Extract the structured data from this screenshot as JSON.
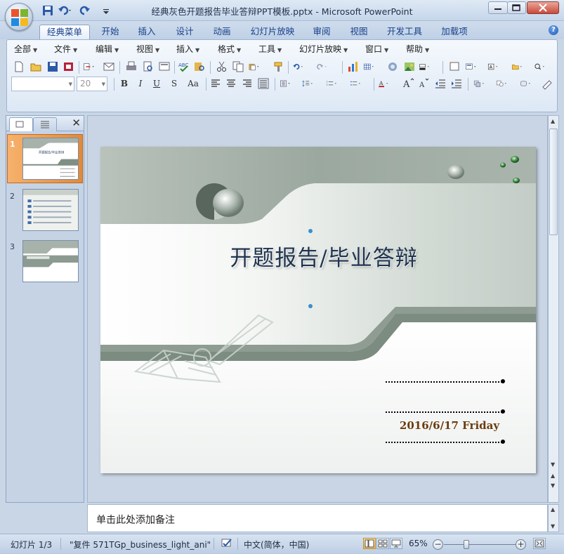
{
  "window": {
    "title": "经典灰色开题报告毕业答辩PPT模板.pptx - Microsoft PowerPoint"
  },
  "ribbon": {
    "tabs": [
      "经典菜单",
      "开始",
      "插入",
      "设计",
      "动画",
      "幻灯片放映",
      "审阅",
      "视图",
      "开发工具",
      "加载项"
    ],
    "active_tab": "经典菜单",
    "menus": [
      "全部",
      "文件",
      "编辑",
      "视图",
      "插入",
      "格式",
      "工具",
      "幻灯片放映",
      "窗口",
      "帮助"
    ],
    "font_name": "",
    "font_size": "20",
    "bold_label": "B",
    "italic_label": "I",
    "underline_label": "U",
    "strike_label": "S",
    "case_label": "Aa"
  },
  "slides_pane": {
    "numbers": [
      "1",
      "2",
      "3"
    ],
    "selected": 1
  },
  "slide": {
    "title": "开题报告/毕业答辩",
    "date": "2016/6/17 Friday"
  },
  "notes": {
    "placeholder": "单击此处添加备注"
  },
  "status": {
    "slide_info": "幻灯片 1/3",
    "theme": "\"复件 571TGp_business_light_ani\"",
    "language": "中文(简体，中国)",
    "zoom": "65%"
  },
  "colors": {
    "accent": "#15428b",
    "slide_band": "#8b9a8f",
    "title_text": "#1f3450",
    "date_text": "#6b3b0e",
    "selection": "#e08a3b"
  }
}
